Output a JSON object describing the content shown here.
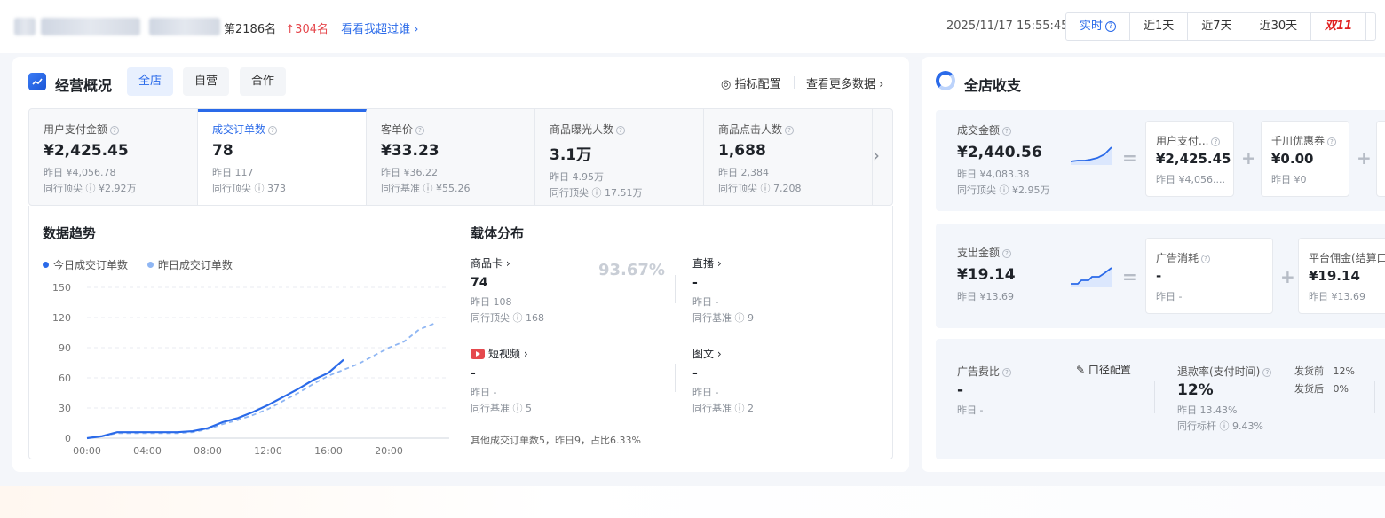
{
  "header": {
    "rank_prefix": "第",
    "rank_number": "2186",
    "rank_suffix": "名",
    "rank_change": "304名",
    "compare_link": "看看我超过谁",
    "datetime": "2025/11/17 15:55:45",
    "tabs": [
      "实时",
      "近1天",
      "近7天",
      "近30天",
      "双11"
    ],
    "active_tab": "实时"
  },
  "overview": {
    "title": "经营概况",
    "scopes": [
      "全店",
      "自营",
      "合作"
    ],
    "config_link": "指标配置",
    "more_link": "查看更多数据",
    "metrics": [
      {
        "label": "用户支付金额",
        "value": "¥2,425.45",
        "sub1": "昨日 ¥4,056.78",
        "sub2": "同行顶尖 ⓘ ¥2.92万"
      },
      {
        "label": "成交订单数",
        "value": "78",
        "sub1": "昨日 117",
        "sub2": "同行顶尖 ⓘ 373"
      },
      {
        "label": "客单价",
        "value": "¥33.23",
        "sub1": "昨日 ¥36.22",
        "sub2": "同行基准 ⓘ ¥55.26"
      },
      {
        "label": "商品曝光人数",
        "value": "3.1万",
        "sub1": "昨日 4.95万",
        "sub2": "同行顶尖 ⓘ 17.51万"
      },
      {
        "label": "商品点击人数",
        "value": "1,688",
        "sub1": "昨日 2,384",
        "sub2": "同行顶尖 ⓘ 7,208"
      }
    ]
  },
  "trend": {
    "title": "数据趋势",
    "legend_today": "今日成交订单数",
    "legend_yesterday": "昨日成交订单数",
    "colors": {
      "today": "#2a6ae9",
      "yesterday": "#8fb6f3"
    }
  },
  "chart_data": {
    "type": "line",
    "x": [
      0,
      1,
      2,
      3,
      4,
      5,
      6,
      7,
      8,
      9,
      10,
      11,
      12,
      13,
      14,
      15,
      16,
      17,
      18,
      19,
      20,
      21,
      22,
      23
    ],
    "xticks": [
      "00:00",
      "04:00",
      "08:00",
      "12:00",
      "16:00",
      "20:00"
    ],
    "xtick_hours": [
      0,
      4,
      8,
      12,
      16,
      20
    ],
    "yticks": [
      "0",
      "30",
      "60",
      "90",
      "120",
      "150"
    ],
    "ylim": [
      0,
      150
    ],
    "series": [
      {
        "name": "今日成交订单数",
        "values": [
          0,
          2,
          6,
          6,
          6,
          6,
          6,
          7,
          10,
          16,
          20,
          26,
          33,
          41,
          49,
          58,
          65,
          78
        ]
      },
      {
        "name": "昨日成交订单数",
        "values": [
          0,
          2,
          5,
          5,
          5,
          5,
          5,
          6,
          9,
          14,
          18,
          23,
          29,
          37,
          45,
          54,
          62,
          68,
          74,
          82,
          90,
          96,
          108,
          114
        ]
      }
    ]
  },
  "carrier": {
    "title": "载体分布",
    "percent": "93.67%",
    "items": [
      {
        "name": "商品卡",
        "value": "74",
        "sub1": "昨日 108",
        "sub2": "同行顶尖 ⓘ 168"
      },
      {
        "name": "直播",
        "value": "-",
        "sub1": "昨日 -",
        "sub2": "同行基准 ⓘ 9"
      },
      {
        "name": "短视频",
        "value": "-",
        "sub1": "昨日 -",
        "sub2": "同行基准 ⓘ 5"
      },
      {
        "name": "图文",
        "value": "-",
        "sub1": "昨日 -",
        "sub2": "同行基准 ⓘ 2"
      }
    ],
    "other_note": "其他成交订单数5，昨日9，占比6.33%"
  },
  "finance": {
    "title": "全店收支",
    "income": {
      "label": "成交金额",
      "value": "¥2,440.56",
      "sub1": "昨日 ¥4,083.38",
      "sub2": "同行顶尖 ⓘ ¥2.95万",
      "parts": [
        {
          "label": "用户支付...",
          "value": "¥2,425.45",
          "sub": "昨日 ¥4,056...."
        },
        {
          "label": "千川优惠券",
          "value": "¥0.00",
          "sub": "昨日 ¥0"
        }
      ]
    },
    "expense": {
      "label": "支出金额",
      "value": "¥19.14",
      "sub1": "昨日 ¥13.69",
      "parts": [
        {
          "label": "广告消耗",
          "value": "-",
          "sub": "昨日 -"
        },
        {
          "label": "平台佣金(结算口",
          "value": "¥19.14",
          "sub": "昨日 ¥13.69"
        }
      ]
    },
    "ads": {
      "label": "广告费比",
      "value": "-",
      "sub": "昨日 -",
      "config": "口径配置"
    },
    "refund": {
      "label": "退款率(支付时间)",
      "value": "12%",
      "sub1": "昨日 13.43%",
      "sub2": "同行标杆 ⓘ 9.43%",
      "pre_label": "发货前",
      "pre_value": "12%",
      "post_label": "发货后",
      "post_value": "0%"
    }
  }
}
